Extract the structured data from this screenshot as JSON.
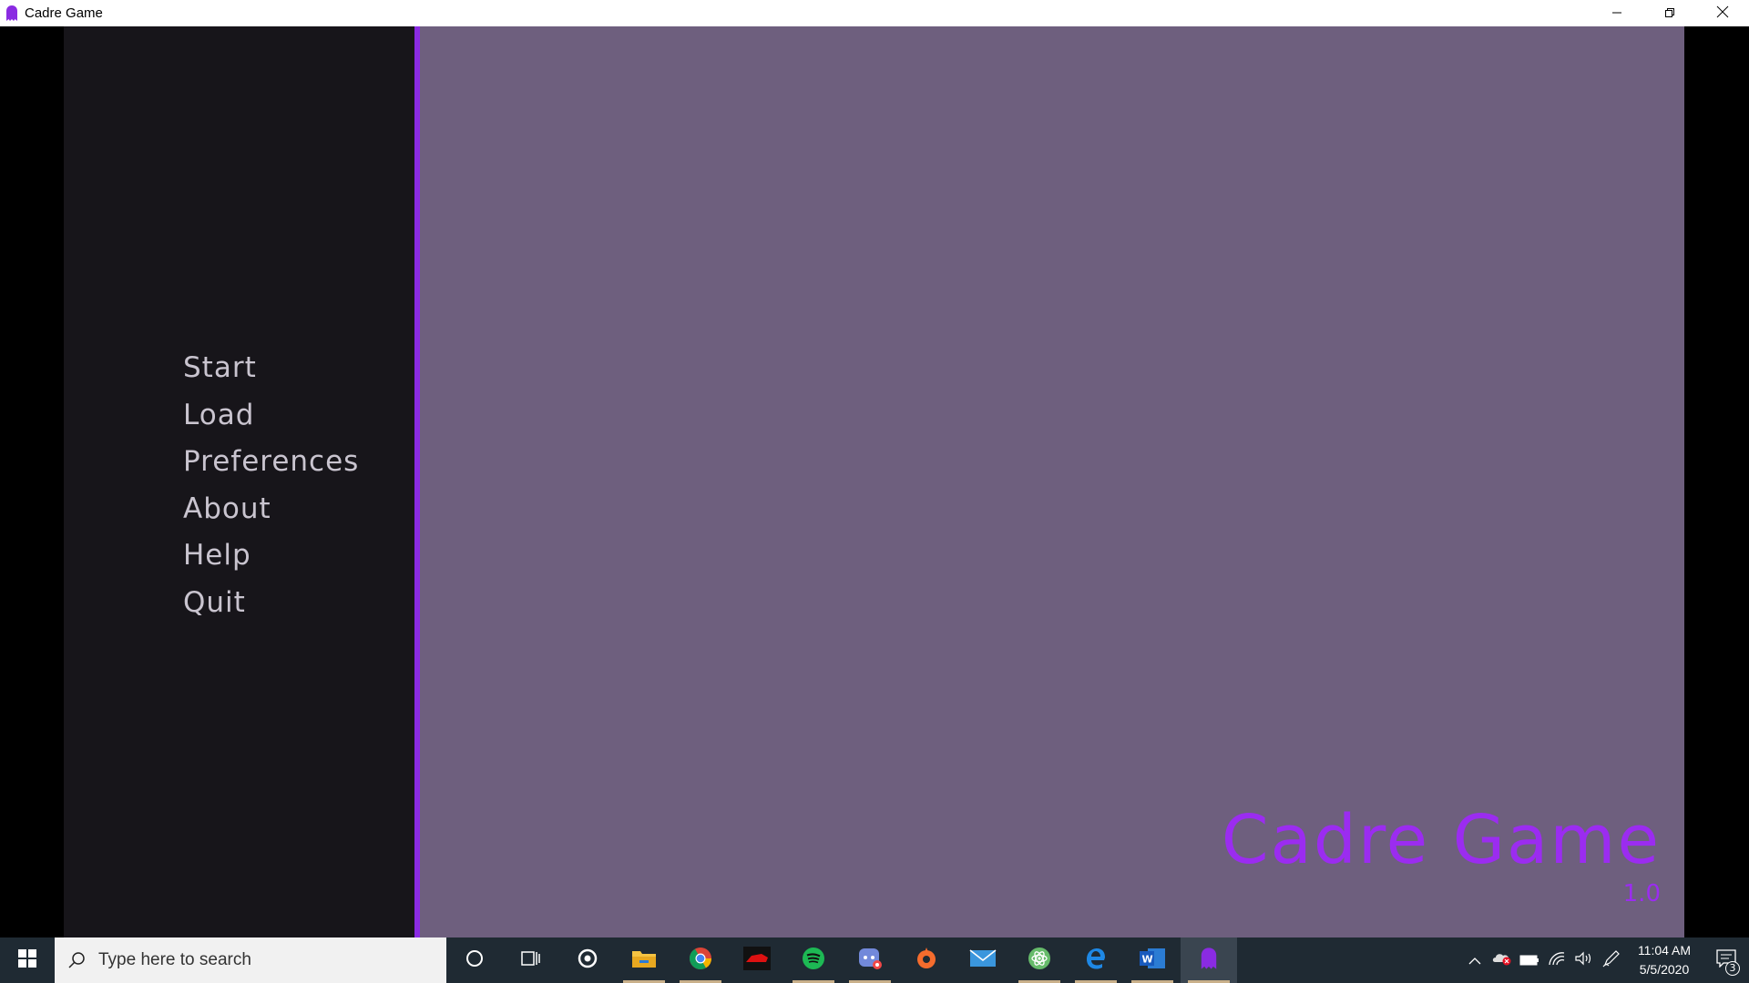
{
  "window": {
    "title": "Cadre Game",
    "icon": "ghost-icon",
    "controls": [
      "minimize-icon",
      "restore-icon",
      "close-icon"
    ]
  },
  "menu": {
    "items": [
      {
        "label": "Start"
      },
      {
        "label": "Load"
      },
      {
        "label": "Preferences"
      },
      {
        "label": "About"
      },
      {
        "label": "Help"
      },
      {
        "label": "Quit"
      }
    ]
  },
  "main": {
    "game_title": "Cadre Game",
    "version": "1.0"
  },
  "colors": {
    "menu_panel": "#17151a",
    "accent": "#8a2be2",
    "main_panel": "#6e5f7e",
    "title_text": "#9b2cf0",
    "menu_text": "#c9c4cf"
  },
  "taskbar": {
    "search_placeholder": "Type here to search",
    "apps": [
      "cortana-icon",
      "task-view-icon",
      "steelseries-icon",
      "file-explorer-icon",
      "chrome-icon",
      "racing-game-icon",
      "spotify-icon",
      "discord-icon",
      "origin-icon",
      "mail-icon",
      "atom-icon",
      "edge-icon",
      "word-icon",
      "cadre-game-icon"
    ],
    "tray": [
      "show-hidden-icons",
      "onedrive-error-icon",
      "battery-icon",
      "wifi-icon",
      "volume-icon",
      "pen-icon"
    ],
    "time": "11:04 AM",
    "date": "5/5/2020",
    "notification_count": "3"
  }
}
